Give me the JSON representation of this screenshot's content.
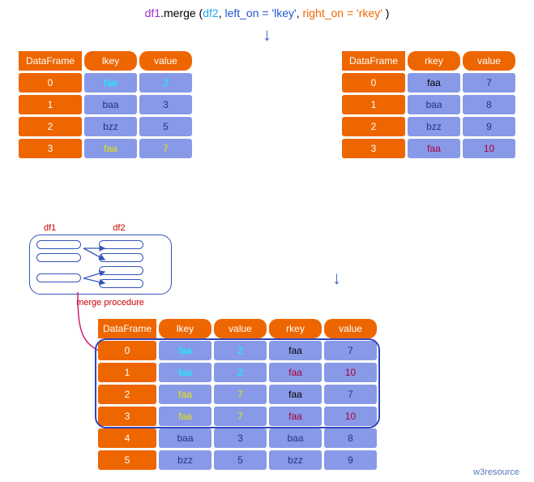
{
  "code": {
    "df1": "df1",
    "dot_merge": ".merge",
    "open": " (",
    "df2": "df2",
    "comma1": ", ",
    "left": "left_on = 'lkey'",
    "comma2": ", ",
    "right": "right_on = 'rkey'",
    "close": " )"
  },
  "headers": {
    "df_label": "DataFrame",
    "lkey": "lkey",
    "rkey": "rkey",
    "value": "value"
  },
  "df1": {
    "rows": [
      {
        "idx": "0",
        "key": "faa",
        "val": "2",
        "kc": "t-cyan",
        "vc": "t-cyan"
      },
      {
        "idx": "1",
        "key": "baa",
        "val": "3",
        "kc": "t-navy",
        "vc": "t-navy"
      },
      {
        "idx": "2",
        "key": "bzz",
        "val": "5",
        "kc": "t-navy",
        "vc": "t-navy"
      },
      {
        "idx": "3",
        "key": "faa",
        "val": "7",
        "kc": "t-yell",
        "vc": "t-yell"
      }
    ]
  },
  "df2": {
    "rows": [
      {
        "idx": "0",
        "key": "faa",
        "val": "7",
        "kc": "t-black",
        "vc": "t-navy"
      },
      {
        "idx": "1",
        "key": "baa",
        "val": "8",
        "kc": "t-navy",
        "vc": "t-navy"
      },
      {
        "idx": "2",
        "key": "bzz",
        "val": "9",
        "kc": "t-navy",
        "vc": "t-navy"
      },
      {
        "idx": "3",
        "key": "faa",
        "val": "10",
        "kc": "t-darkred",
        "vc": "t-darkred"
      }
    ]
  },
  "merge_proc": {
    "l1": "df1",
    "l2": "df2",
    "caption": "merge procedure"
  },
  "result": {
    "rows": [
      {
        "idx": "0",
        "lkey": "faa",
        "lv": "2",
        "rkey": "faa",
        "rv": "7",
        "lkc": "t-cyan",
        "lvc": "t-cyan",
        "rkc": "t-black",
        "rvc": "t-navy"
      },
      {
        "idx": "1",
        "lkey": "faa",
        "lv": "2",
        "rkey": "faa",
        "rv": "10",
        "lkc": "t-cyan",
        "lvc": "t-cyan",
        "rkc": "t-darkred",
        "rvc": "t-darkred"
      },
      {
        "idx": "2",
        "lkey": "faa",
        "lv": "7",
        "rkey": "faa",
        "rv": "7",
        "lkc": "t-yell",
        "lvc": "t-yell",
        "rkc": "t-black",
        "rvc": "t-navy"
      },
      {
        "idx": "3",
        "lkey": "faa",
        "lv": "7",
        "rkey": "faa",
        "rv": "10",
        "lkc": "t-yell",
        "lvc": "t-yell",
        "rkc": "t-darkred",
        "rvc": "t-darkred"
      },
      {
        "idx": "4",
        "lkey": "baa",
        "lv": "3",
        "rkey": "baa",
        "rv": "8",
        "lkc": "t-navy",
        "lvc": "t-navy",
        "rkc": "t-navy",
        "rvc": "t-navy"
      },
      {
        "idx": "5",
        "lkey": "bzz",
        "lv": "5",
        "rkey": "bzz",
        "rv": "9",
        "lkc": "t-navy",
        "lvc": "t-navy",
        "rkc": "t-navy",
        "rvc": "t-navy"
      }
    ]
  },
  "attribution": "w3resource"
}
